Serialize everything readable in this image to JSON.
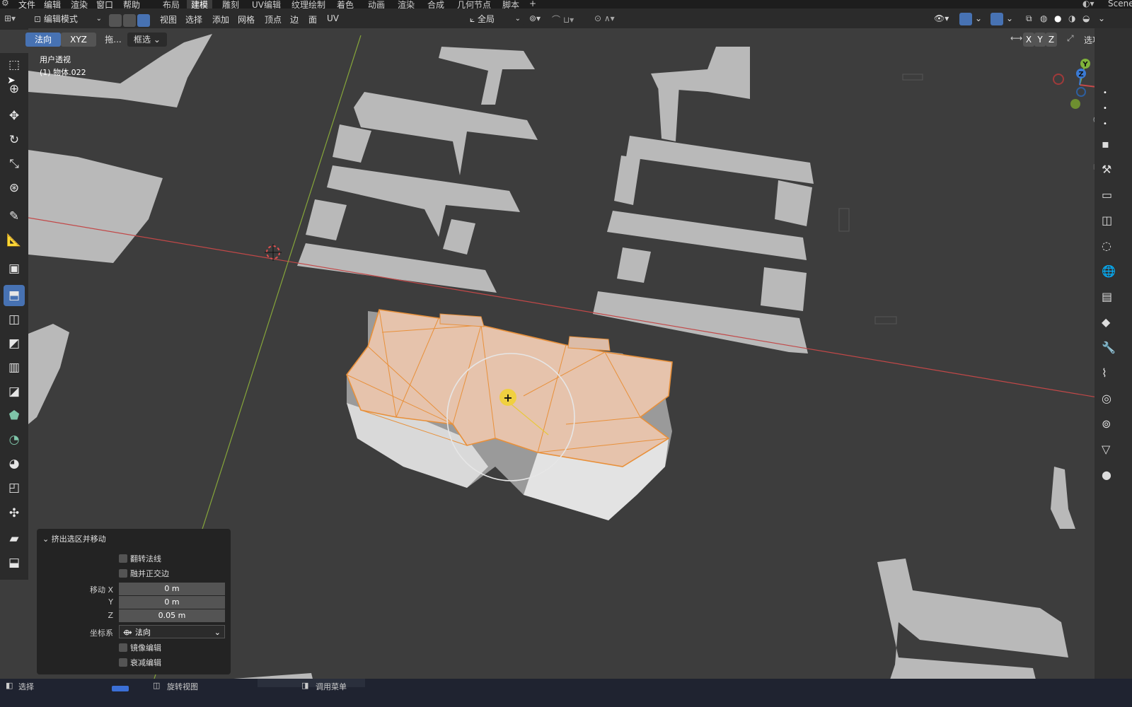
{
  "top_menu": {
    "items": [
      "文件",
      "编辑",
      "渲染",
      "窗口",
      "帮助"
    ],
    "workspaces": [
      "布局",
      "建模",
      "雕刻",
      "UV编辑",
      "纹理绘制",
      "着色",
      "动画",
      "渲染",
      "合成",
      "几何节点",
      "脚本"
    ],
    "active_workspace": "建模",
    "add_tab": "+",
    "scene": "Scene"
  },
  "header": {
    "mode": "编辑模式",
    "menus": [
      "视图",
      "选择",
      "添加",
      "网格",
      "顶点",
      "边",
      "面",
      "UV"
    ],
    "transform_orientation": "全局"
  },
  "subheader": {
    "orientation": "法向",
    "axes": "XYZ",
    "drag": "拖...",
    "select_mode": "框选",
    "options": "选项",
    "mirror_axes": [
      "X",
      "Y",
      "Z"
    ]
  },
  "viewport": {
    "view_name": "用户透视",
    "object_name": "(1) 物体.022"
  },
  "gizmo": {
    "x": "X",
    "y": "Y",
    "z": "Z"
  },
  "toolbar_icons": [
    "select-box-icon",
    "cursor-icon",
    "move-icon",
    "rotate-icon",
    "scale-icon",
    "transform-icon",
    "annotate-icon",
    "measure-icon",
    "add-cube-icon",
    "extrude-region-icon",
    "inset-faces-icon",
    "bevel-icon",
    "loop-cut-icon",
    "knife-icon",
    "poly-build-icon",
    "spin-icon",
    "smooth-icon",
    "edge-slide-icon",
    "shrink-fatten-icon",
    "shear-icon",
    "rip-region-icon"
  ],
  "operator_panel": {
    "title": "挤出选区并移动",
    "flip_normals": "翻转法线",
    "dissolve_orthogonal": "融并正交边",
    "move_x_label": "移动 X",
    "y_label": "Y",
    "z_label": "Z",
    "move_x": "0 m",
    "move_y": "0 m",
    "move_z": "0.05 m",
    "orientation_label": "坐标系",
    "orientation_value": "法向",
    "proportional_editing": "镜像编辑",
    "falloff_editing": "衰减编辑"
  },
  "status_bar": {
    "left": "选择",
    "middle": "旋转视图",
    "right": "调用菜单"
  },
  "colors": {
    "accent": "#4772b3",
    "selection": "#f0a050",
    "x_axis": "#d14b4b",
    "y_axis": "#8fb03a",
    "background": "#3d3d3d"
  }
}
